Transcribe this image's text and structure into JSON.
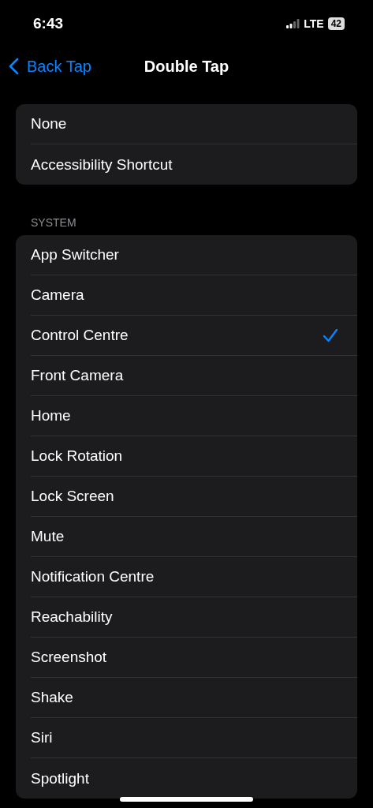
{
  "status_bar": {
    "time": "6:43",
    "network": "LTE",
    "battery": "42"
  },
  "nav": {
    "back": "Back Tap",
    "title": "Double Tap"
  },
  "groups": [
    {
      "items": [
        {
          "label": "None",
          "selected": false
        },
        {
          "label": "Accessibility Shortcut",
          "selected": false
        }
      ]
    },
    {
      "header": "SYSTEM",
      "items": [
        {
          "label": "App Switcher",
          "selected": false
        },
        {
          "label": "Camera",
          "selected": false
        },
        {
          "label": "Control Centre",
          "selected": true
        },
        {
          "label": "Front Camera",
          "selected": false
        },
        {
          "label": "Home",
          "selected": false
        },
        {
          "label": "Lock Rotation",
          "selected": false
        },
        {
          "label": "Lock Screen",
          "selected": false
        },
        {
          "label": "Mute",
          "selected": false
        },
        {
          "label": "Notification Centre",
          "selected": false
        },
        {
          "label": "Reachability",
          "selected": false
        },
        {
          "label": "Screenshot",
          "selected": false
        },
        {
          "label": "Shake",
          "selected": false
        },
        {
          "label": "Siri",
          "selected": false
        },
        {
          "label": "Spotlight",
          "selected": false
        }
      ]
    }
  ]
}
